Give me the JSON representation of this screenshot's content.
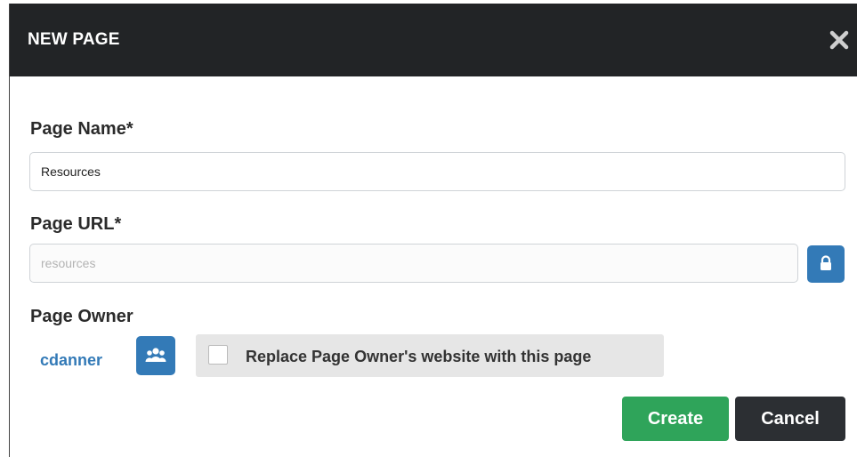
{
  "dialog": {
    "title": "NEW PAGE",
    "close_icon": "close-icon"
  },
  "form": {
    "page_name_label": "Page Name*",
    "page_name_value": "Resources",
    "page_url_label": "Page URL*",
    "page_url_placeholder": "resources",
    "page_url_value": "",
    "lock_icon": "lock-icon",
    "page_owner_label": "Page Owner",
    "owner_name": "cdanner",
    "users_icon": "users-icon",
    "replace_label": "Replace Page Owner's website with this page",
    "replace_checked": false
  },
  "actions": {
    "create_label": "Create",
    "cancel_label": "Cancel"
  },
  "colors": {
    "header_bg": "#222426",
    "primary": "#337ab7",
    "success": "#2fa45a",
    "dark": "#2c2f33"
  }
}
